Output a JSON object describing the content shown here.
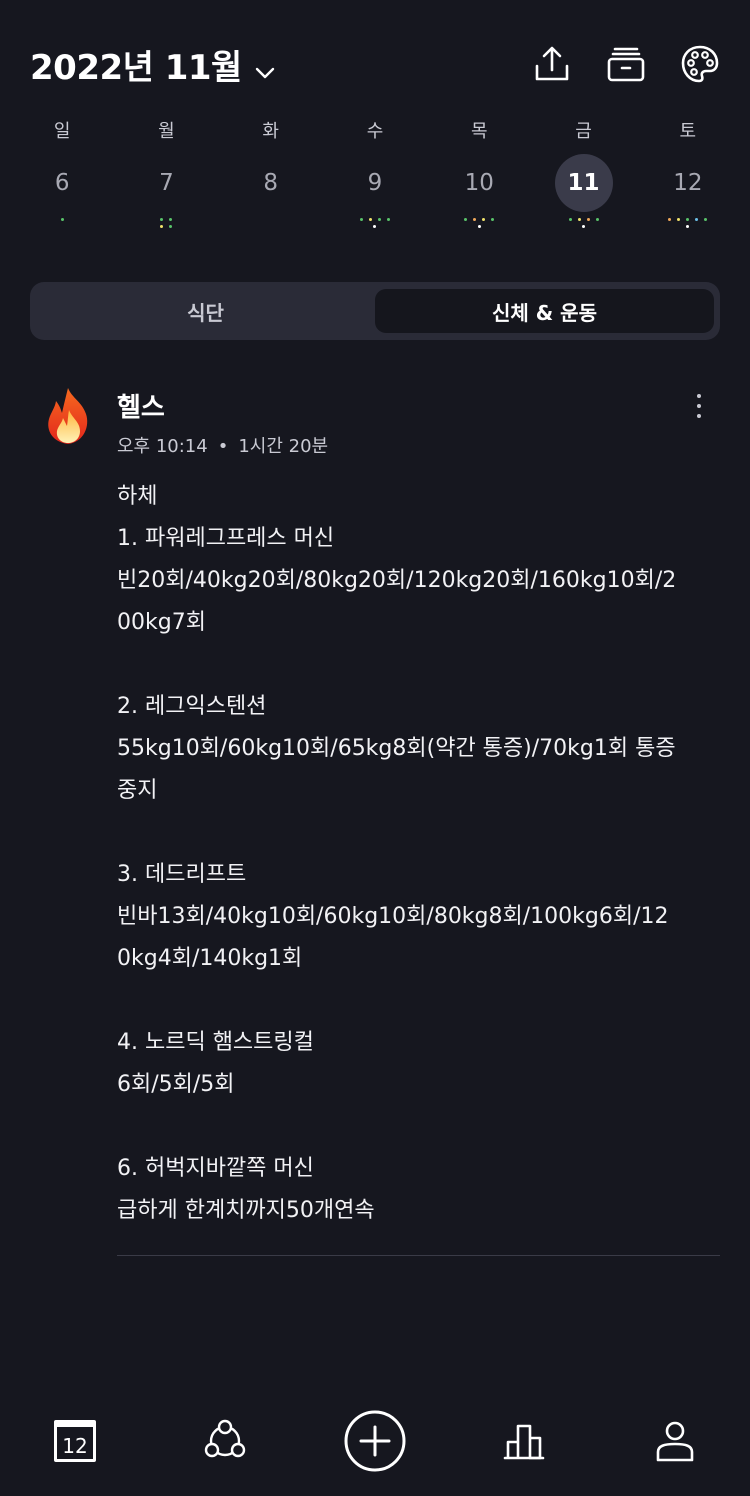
{
  "header": {
    "month_title": "2022년 11월"
  },
  "week": [
    {
      "weekday": "일",
      "date": "6",
      "dots": [
        [
          "#59c36a"
        ],
        []
      ]
    },
    {
      "weekday": "월",
      "date": "7",
      "dots": [
        [
          "#59c36a",
          "#59c36a"
        ],
        [
          "#f0e26b",
          "#59c36a"
        ]
      ]
    },
    {
      "weekday": "화",
      "date": "8",
      "dots": [
        [],
        []
      ]
    },
    {
      "weekday": "수",
      "date": "9",
      "dots": [
        [
          "#59c36a",
          "#f0e26b",
          "#59c36a",
          "#59c36a"
        ],
        [
          "#ffffff"
        ]
      ]
    },
    {
      "weekday": "목",
      "date": "10",
      "dots": [
        [
          "#59c36a",
          "#f0a85a",
          "#f0e26b",
          "#59c36a"
        ],
        [
          "#ffffff"
        ]
      ]
    },
    {
      "weekday": "금",
      "date": "11",
      "selected": true,
      "dots": [
        [
          "#59c36a",
          "#f0e26b",
          "#f0a85a",
          "#59c36a"
        ],
        [
          "#ffffff"
        ]
      ]
    },
    {
      "weekday": "토",
      "date": "12",
      "dots": [
        [
          "#f0a85a",
          "#f0e26b",
          "#59c36a",
          "#6cc0e8",
          "#59c36a"
        ],
        [
          "#ffffff"
        ]
      ]
    }
  ],
  "tabs": {
    "diet": "식단",
    "body_exercise": "신체 & 운동"
  },
  "entry": {
    "title": "헬스",
    "time": "오후 10:14",
    "separator": "•",
    "duration": "1시간 20분",
    "note": "하체\n1. 파워레그프레스 머신\n빈20회/40kg20회/80kg20회/120kg20회/160kg10회/200kg7회\n\n2. 레그익스텐션\n55kg10회/60kg10회/65kg8회(약간 통증)/70kg1회 통증중지\n\n3. 데드리프트\n빈바13회/40kg10회/60kg10회/80kg8회/100kg6회/120kg4회/140kg1회\n\n4. 노르딕 햄스트링컬\n6회/5회/5회\n\n6. 허벅지바깥쪽 머신\n급하게 한계치까지50개연속"
  },
  "bottom_nav": {
    "calendar_day": "12"
  },
  "colors": {
    "background": "#16171f",
    "segment_bg": "#2a2b37",
    "selected_day_bg": "#3a3b4a"
  }
}
